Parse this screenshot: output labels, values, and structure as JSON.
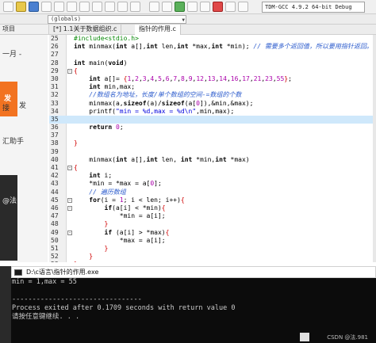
{
  "toolbar": {
    "compiler": "TDM-GCC 4.9.2 64-bit Debug",
    "scope": "(globals)"
  },
  "left_panel": {
    "tab_label": "项目",
    "texts": [
      "一月 -",
      "发",
      "接",
      "汇助手",
      "@法"
    ],
    "orange_badge": "发"
  },
  "tabs": [
    {
      "label": "[*] 1.1关于数据组织.c"
    },
    {
      "label": "指针的作用.c"
    }
  ],
  "editor": {
    "lines": [
      {
        "n": "25",
        "fold": "",
        "code": "#include<stdio.h>",
        "cls": "pp"
      },
      {
        "n": "26",
        "fold": "",
        "code": "int minmax(int a[],int len,int *max,int *min); // 需要多个返回值，所以要用指针返回。",
        "cls": "mix1"
      },
      {
        "n": "27",
        "fold": "",
        "code": "",
        "cls": ""
      },
      {
        "n": "28",
        "fold": "",
        "code": "int main(void)",
        "cls": "kwline"
      },
      {
        "n": "29",
        "fold": "-",
        "code": "{",
        "cls": "red"
      },
      {
        "n": "30",
        "fold": "",
        "code": "    int a[]= {1,2,3,4,5,6,7,8,9,12,13,14,16,17,21,23,55};",
        "cls": "arr"
      },
      {
        "n": "31",
        "fold": "",
        "code": "    int min,max;",
        "cls": "kwline"
      },
      {
        "n": "32",
        "fold": "",
        "code": "    //数组名为地址，长度/单个数组的空间-=数组的个数",
        "cls": "cm"
      },
      {
        "n": "33",
        "fold": "",
        "code": "    minmax(a,sizeof(a)/sizeof(a[0]),&min,&max);",
        "cls": "plain"
      },
      {
        "n": "34",
        "fold": "",
        "code": "    printf(\"min = %d,max = %d\\n\",min,max);",
        "cls": "printf"
      },
      {
        "n": "35",
        "fold": "",
        "code": "",
        "cls": "hl"
      },
      {
        "n": "36",
        "fold": "",
        "code": "    return 0;",
        "cls": "kwline"
      },
      {
        "n": "37",
        "fold": "",
        "code": "",
        "cls": ""
      },
      {
        "n": "38",
        "fold": "",
        "code": "}",
        "cls": "red"
      },
      {
        "n": "39",
        "fold": "",
        "code": "",
        "cls": ""
      },
      {
        "n": "40",
        "fold": "",
        "code": "    minmax(int a[],int len, int *min,int *max)",
        "cls": "plain"
      },
      {
        "n": "41",
        "fold": "-",
        "code": "{",
        "cls": "red"
      },
      {
        "n": "42",
        "fold": "",
        "code": "    int i;",
        "cls": "kwline"
      },
      {
        "n": "43",
        "fold": "",
        "code": "    *min = *max = a[0];",
        "cls": "plain"
      },
      {
        "n": "44",
        "fold": "",
        "code": "    // 遍历数组",
        "cls": "cm"
      },
      {
        "n": "45",
        "fold": "-",
        "code": "    for(i = 1; i < len; i++){",
        "cls": "plain"
      },
      {
        "n": "46",
        "fold": "-",
        "code": "        if(a[i] < *min){",
        "cls": "plain"
      },
      {
        "n": "47",
        "fold": "",
        "code": "            *min = a[i];",
        "cls": "plain"
      },
      {
        "n": "48",
        "fold": "",
        "code": "        }",
        "cls": "red"
      },
      {
        "n": "49",
        "fold": "-",
        "code": "        if (a[i] > *max){",
        "cls": "plain"
      },
      {
        "n": "50",
        "fold": "",
        "code": "            *max = a[i];",
        "cls": "plain"
      },
      {
        "n": "51",
        "fold": "",
        "code": "        }",
        "cls": "red"
      },
      {
        "n": "52",
        "fold": "",
        "code": "    }",
        "cls": "red"
      },
      {
        "n": "53",
        "fold": "",
        "code": "}",
        "cls": "red"
      }
    ]
  },
  "console": {
    "title": "D:\\c语言\\指针的作用.exe",
    "lines": [
      "min = 1,max = 55",
      "",
      "--------------------------------",
      "Process exited after 0.1709 seconds with return value 0",
      "请按任意键继续. . ."
    ],
    "watermark": "CSDN @法.981"
  }
}
